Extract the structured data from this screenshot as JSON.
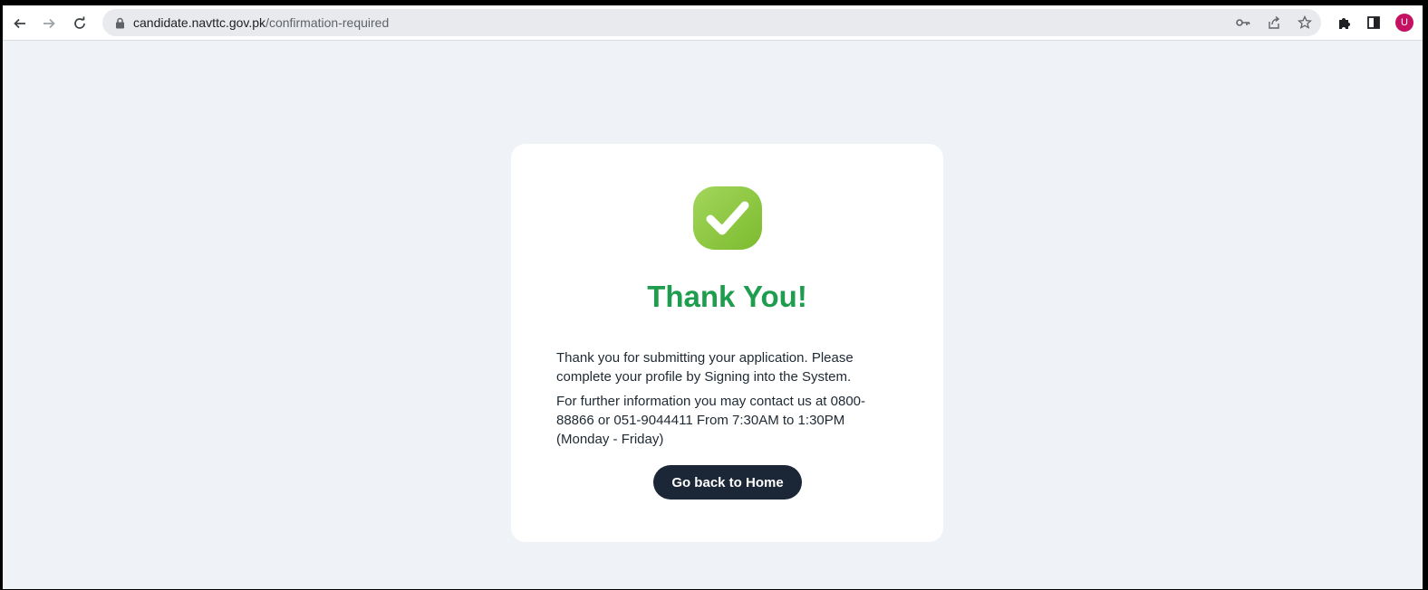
{
  "browser": {
    "url_host": "candidate.navttc.gov.pk",
    "url_path": "/confirmation-required",
    "profile_initial": "U"
  },
  "icons": {
    "back": "back-arrow-icon",
    "forward": "forward-arrow-icon",
    "reload": "reload-icon",
    "lock": "lock-icon",
    "key": "key-icon",
    "share": "share-icon",
    "bookmark": "star-icon",
    "extensions": "puzzle-icon",
    "side_panel": "side-panel-icon",
    "success": "checkmark-icon"
  },
  "colors": {
    "title": "#1f9d4f",
    "check_bg": "#8cc63f",
    "button_bg": "#1b2636",
    "page_bg": "#eff2f7"
  },
  "confirmation": {
    "title": "Thank You!",
    "message": "Thank you for submitting your application. Please complete your profile by Signing into the System.",
    "contact": "For further information you may contact us at 0800-88866 or 051-9044411 From 7:30AM to 1:30PM (Monday - Friday)",
    "button_label": "Go back to Home"
  }
}
